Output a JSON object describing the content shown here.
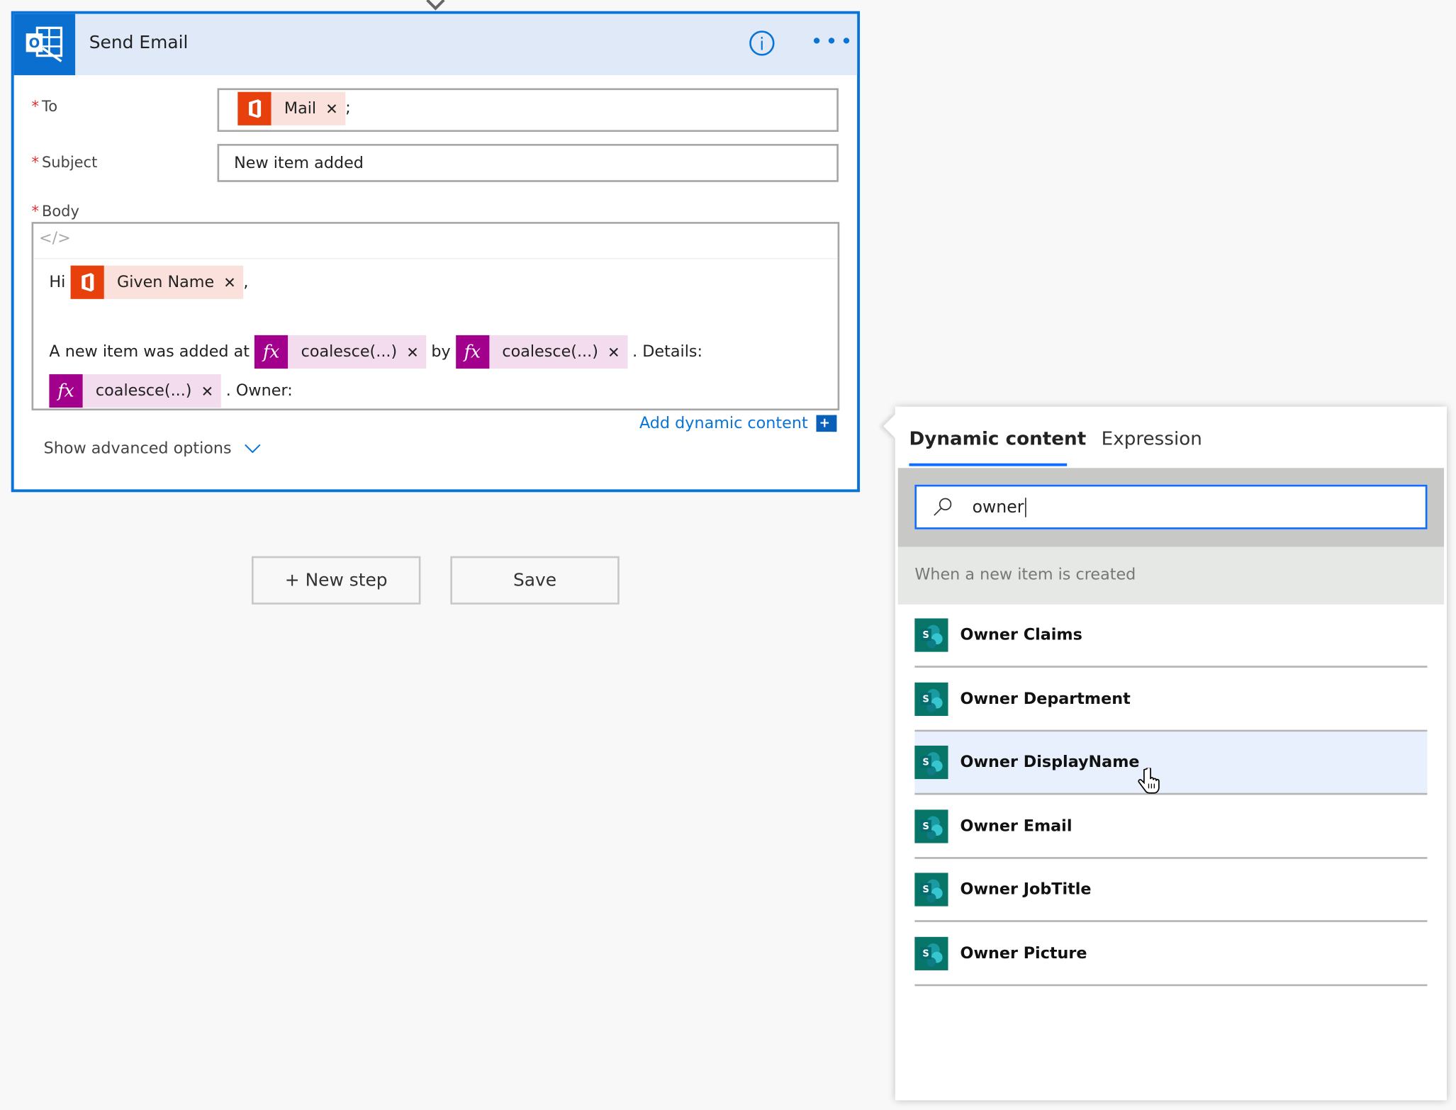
{
  "card": {
    "title": "Send Email",
    "to_label": "To",
    "to_token": "Mail",
    "to_separator": ";",
    "subject_label": "Subject",
    "subject_value": "New item added",
    "body_label": "Body",
    "body": {
      "line1_prefix": "Hi",
      "given_name_token": "Given Name",
      "line1_suffix": ",",
      "line2_prefix": "A new item was added at",
      "token_fx": "coalesce(...)",
      "by_text": "by",
      "details_text": ". Details:",
      "owner_text": ". Owner:"
    },
    "add_dynamic_content": "Add dynamic content",
    "show_advanced": "Show advanced options"
  },
  "buttons": {
    "new_step": "+ New step",
    "save": "Save"
  },
  "panel": {
    "tabs": [
      {
        "label": "Dynamic content",
        "active": true
      },
      {
        "label": "Expression",
        "active": false
      }
    ],
    "search_value": "owner",
    "section": "When a new item is created",
    "items": [
      {
        "label": "Owner Claims"
      },
      {
        "label": "Owner Department"
      },
      {
        "label": "Owner DisplayName",
        "hovered": true
      },
      {
        "label": "Owner Email"
      },
      {
        "label": "Owner JobTitle"
      },
      {
        "label": "Owner Picture"
      }
    ]
  },
  "colors": {
    "accent": "#0a74d6",
    "office": "#e8400c",
    "fx": "#a2008c",
    "sharepoint": "#077568"
  }
}
